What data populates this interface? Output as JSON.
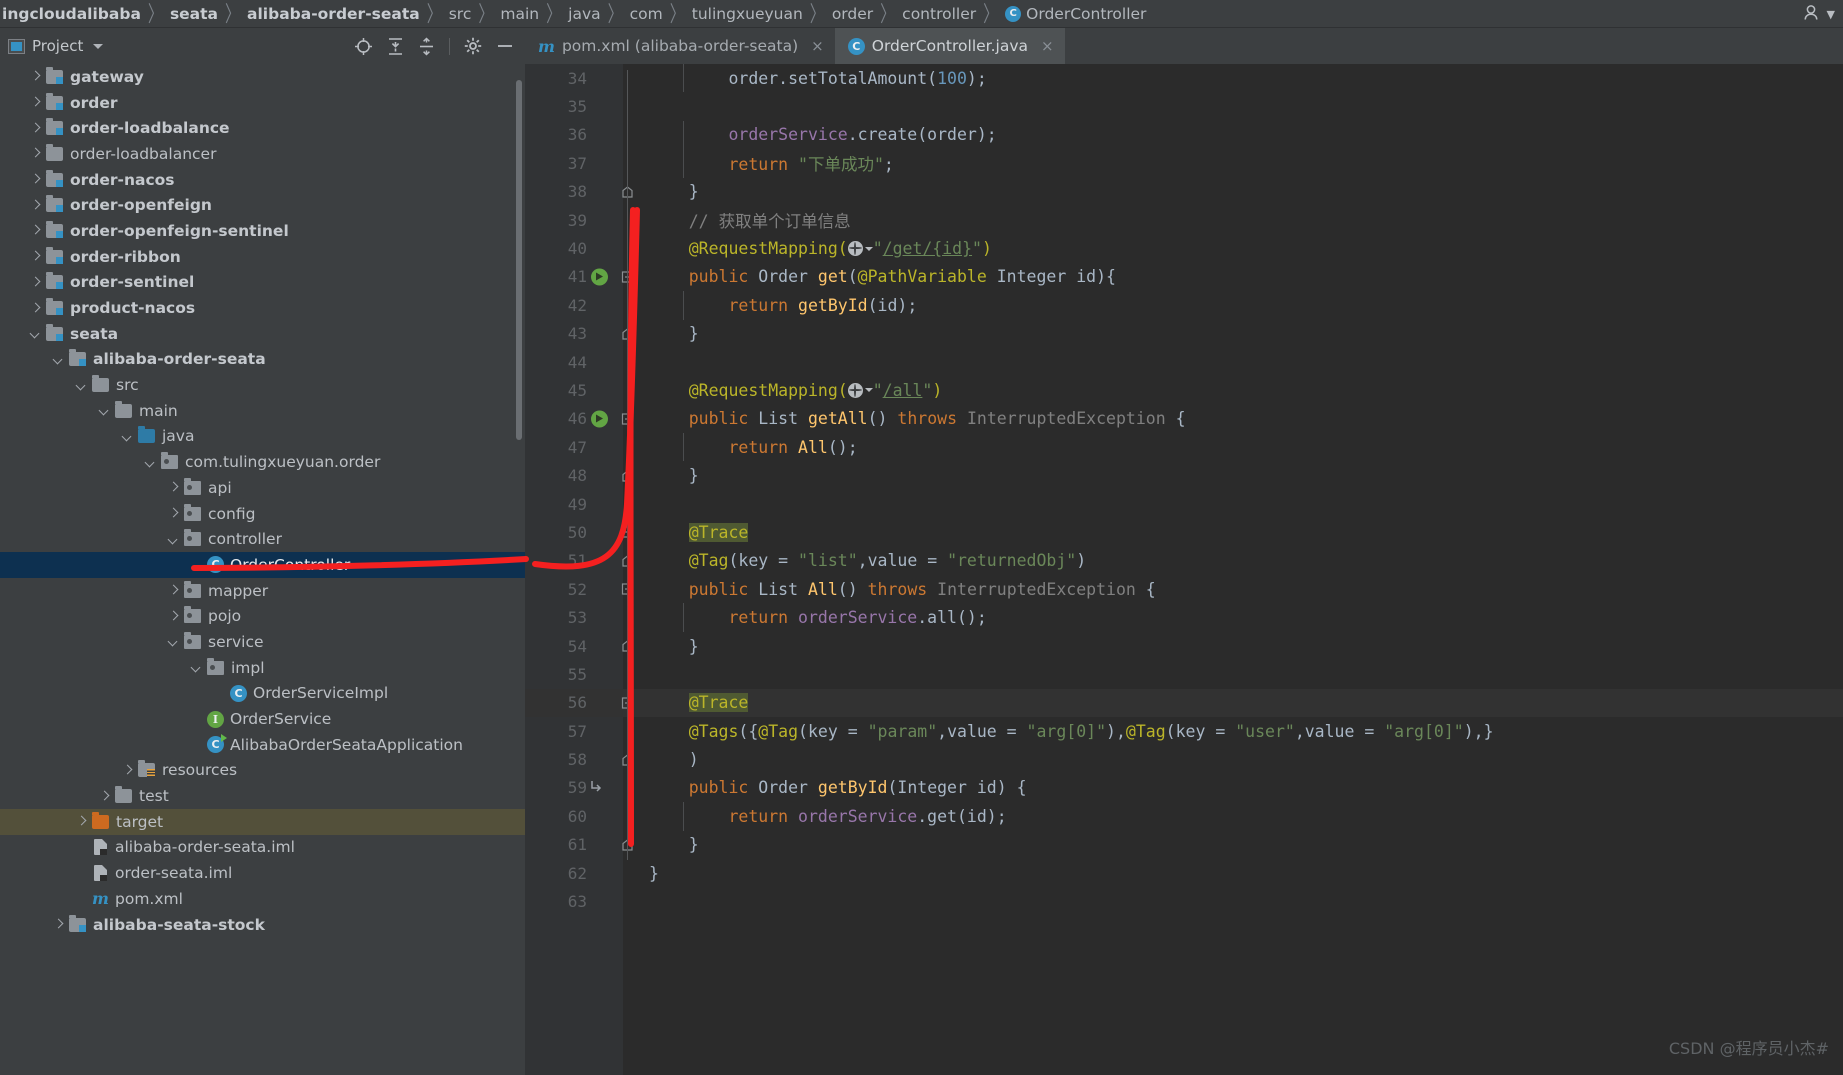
{
  "breadcrumb": {
    "items": [
      {
        "label": "ingcloudalibaba",
        "bold": true
      },
      {
        "label": "seata",
        "bold": true
      },
      {
        "label": "alibaba-order-seata",
        "bold": true
      },
      {
        "label": "src",
        "bold": false
      },
      {
        "label": "main",
        "bold": false
      },
      {
        "label": "java",
        "bold": false
      },
      {
        "label": "com",
        "bold": false
      },
      {
        "label": "tulingxueyuan",
        "bold": false
      },
      {
        "label": "order",
        "bold": false
      },
      {
        "label": "controller",
        "bold": false
      },
      {
        "label": "OrderController",
        "bold": false,
        "icon": "class-icon"
      }
    ],
    "separator": "〉",
    "account_icon": "account-icon",
    "account_caret": "▾"
  },
  "tool_window": {
    "title": "Project",
    "caret": "chevron-down-icon",
    "actions": [
      {
        "name": "locate-icon"
      },
      {
        "name": "expand-all-icon"
      },
      {
        "name": "collapse-all-icon"
      },
      {
        "name": "gear-icon"
      },
      {
        "name": "hide-icon"
      }
    ]
  },
  "tabs": [
    {
      "label": "pom.xml (alibaba-order-seata)",
      "icon": "maven-icon",
      "active": false,
      "close": "×"
    },
    {
      "label": "OrderController.java",
      "icon": "class-icon",
      "active": true,
      "close": "×"
    }
  ],
  "tree": [
    {
      "label": "gateway",
      "indent": 1,
      "arrow": "closed",
      "icon": "module-folder",
      "bold": true
    },
    {
      "label": "order",
      "indent": 1,
      "arrow": "closed",
      "icon": "module-folder",
      "bold": true
    },
    {
      "label": "order-loadbalance",
      "indent": 1,
      "arrow": "closed",
      "icon": "module-folder",
      "bold": true
    },
    {
      "label": "order-loadbalancer",
      "indent": 1,
      "arrow": "closed",
      "icon": "folder",
      "bold": false
    },
    {
      "label": "order-nacos",
      "indent": 1,
      "arrow": "closed",
      "icon": "module-folder",
      "bold": true
    },
    {
      "label": "order-openfeign",
      "indent": 1,
      "arrow": "closed",
      "icon": "module-folder",
      "bold": true
    },
    {
      "label": "order-openfeign-sentinel",
      "indent": 1,
      "arrow": "closed",
      "icon": "module-folder",
      "bold": true
    },
    {
      "label": "order-ribbon",
      "indent": 1,
      "arrow": "closed",
      "icon": "module-folder",
      "bold": true
    },
    {
      "label": "order-sentinel",
      "indent": 1,
      "arrow": "closed",
      "icon": "module-folder",
      "bold": true
    },
    {
      "label": "product-nacos",
      "indent": 1,
      "arrow": "closed",
      "icon": "module-folder",
      "bold": true
    },
    {
      "label": "seata",
      "indent": 1,
      "arrow": "open",
      "icon": "module-folder",
      "bold": true
    },
    {
      "label": "alibaba-order-seata",
      "indent": 2,
      "arrow": "open",
      "icon": "module-folder",
      "bold": true
    },
    {
      "label": "src",
      "indent": 3,
      "arrow": "open",
      "icon": "folder",
      "bold": false
    },
    {
      "label": "main",
      "indent": 4,
      "arrow": "open",
      "icon": "folder",
      "bold": false
    },
    {
      "label": "java",
      "indent": 5,
      "arrow": "open",
      "icon": "source-folder",
      "bold": false
    },
    {
      "label": "com.tulingxueyuan.order",
      "indent": 6,
      "arrow": "open",
      "icon": "package",
      "bold": false
    },
    {
      "label": "api",
      "indent": 7,
      "arrow": "closed",
      "icon": "package",
      "bold": false
    },
    {
      "label": "config",
      "indent": 7,
      "arrow": "closed",
      "icon": "package",
      "bold": false
    },
    {
      "label": "controller",
      "indent": 7,
      "arrow": "open",
      "icon": "package",
      "bold": false
    },
    {
      "label": "OrderController",
      "indent": 8,
      "arrow": "none",
      "icon": "class",
      "bold": false,
      "selected": true
    },
    {
      "label": "mapper",
      "indent": 7,
      "arrow": "closed",
      "icon": "package",
      "bold": false
    },
    {
      "label": "pojo",
      "indent": 7,
      "arrow": "closed",
      "icon": "package",
      "bold": false
    },
    {
      "label": "service",
      "indent": 7,
      "arrow": "open",
      "icon": "package",
      "bold": false
    },
    {
      "label": "impl",
      "indent": 8,
      "arrow": "open",
      "icon": "package",
      "bold": false
    },
    {
      "label": "OrderServiceImpl",
      "indent": 9,
      "arrow": "none",
      "icon": "class",
      "bold": false
    },
    {
      "label": "OrderService",
      "indent": 8,
      "arrow": "none",
      "icon": "interface",
      "bold": false
    },
    {
      "label": "AlibabaOrderSeataApplication",
      "indent": 8,
      "arrow": "none",
      "icon": "springboot",
      "bold": false
    },
    {
      "label": "resources",
      "indent": 5,
      "arrow": "closed",
      "icon": "resources-folder",
      "bold": false
    },
    {
      "label": "test",
      "indent": 4,
      "arrow": "closed",
      "icon": "folder",
      "bold": false
    },
    {
      "label": "target",
      "indent": 3,
      "arrow": "closed",
      "icon": "excluded-folder",
      "bold": false,
      "excluded": true
    },
    {
      "label": "alibaba-order-seata.iml",
      "indent": 3,
      "arrow": "none",
      "icon": "iml",
      "bold": false
    },
    {
      "label": "order-seata.iml",
      "indent": 3,
      "arrow": "none",
      "icon": "iml",
      "bold": false
    },
    {
      "label": "pom.xml",
      "indent": 3,
      "arrow": "none",
      "icon": "maven",
      "bold": false
    },
    {
      "label": "alibaba-seata-stock",
      "indent": 2,
      "arrow": "closed",
      "icon": "module-folder",
      "bold": true
    }
  ],
  "code": {
    "first_line": 34,
    "lines": [
      {
        "n": 34,
        "indent": 2
      },
      {
        "n": 35
      },
      {
        "n": 36,
        "indent": 2
      },
      {
        "n": 37,
        "indent": 2
      },
      {
        "n": 38,
        "indent": 1,
        "fold": "end"
      },
      {
        "n": 39,
        "indent": 1
      },
      {
        "n": 40,
        "indent": 1
      },
      {
        "n": 41,
        "indent": 1,
        "fold": "start",
        "run": true
      },
      {
        "n": 42,
        "indent": 2
      },
      {
        "n": 43,
        "indent": 1,
        "fold": "end"
      },
      {
        "n": 44
      },
      {
        "n": 45,
        "indent": 1
      },
      {
        "n": 46,
        "indent": 1,
        "fold": "start",
        "run": true
      },
      {
        "n": 47,
        "indent": 2
      },
      {
        "n": 48,
        "indent": 1,
        "fold": "end"
      },
      {
        "n": 49
      },
      {
        "n": 50,
        "indent": 1,
        "fold": "start"
      },
      {
        "n": 51,
        "indent": 1,
        "fold": "end"
      },
      {
        "n": 52,
        "indent": 1,
        "fold": "start"
      },
      {
        "n": 53,
        "indent": 2
      },
      {
        "n": 54,
        "indent": 1,
        "fold": "end"
      },
      {
        "n": 55
      },
      {
        "n": 56,
        "indent": 1,
        "fold": "start",
        "current": true
      },
      {
        "n": 57,
        "indent": 1
      },
      {
        "n": 58,
        "indent": 1,
        "fold": "end"
      },
      {
        "n": 59,
        "indent": 1,
        "override": true
      },
      {
        "n": 60,
        "indent": 2
      },
      {
        "n": 61,
        "indent": 1,
        "fold": "end"
      },
      {
        "n": 62
      },
      {
        "n": 63
      }
    ],
    "text": {
      "l34_a": "order",
      "l34_b": ".setTotalAmount(",
      "l34_num": "100",
      "l34_c": ");",
      "l36_a": "orderService",
      "l36_b": ".create(order);",
      "l37_kw": "return",
      "l37_str": "\"下单成功\"",
      "l37_end": ";",
      "l38": "}",
      "l39_cmt": "//",
      "l39_text": "获取单个订单信息",
      "l40_anno": "@RequestMapping(",
      "l40_str_open": "\"",
      "l40_url": "/get/{id}",
      "l40_str_close": "\"",
      "l40_end": ")",
      "l41_kw": "public",
      "l41_type": "Order",
      "l41_fn": "get",
      "l41_open": "(",
      "l41_anno": "@PathVariable",
      "l41_param": "Integer id",
      "l41_close": "){",
      "l42_kw": "return",
      "l42_fn": "getById",
      "l42_end": "(id);",
      "l43": "}",
      "l45_anno": "@RequestMapping(",
      "l45_url": "/all",
      "l45_end": ")",
      "l46_kw": "public",
      "l46_type": "List<Order>",
      "l46_fn": "getAll",
      "l46_mid": "() ",
      "l46_kw2": "throws",
      "l46_exc": "InterruptedException",
      "l46_brace": " {",
      "l47_kw": "return",
      "l47_fn": "All",
      "l47_end": "();",
      "l48": "}",
      "l50_anno": "@Trace",
      "l51_anno": "@Tag",
      "l51_open": "(key = ",
      "l51_str1": "\"list\"",
      "l51_mid": ",value = ",
      "l51_str2": "\"returnedObj\"",
      "l51_close": ")",
      "l52_kw": "public",
      "l52_type": "List<Order>",
      "l52_fn": "All",
      "l52_mid": "() ",
      "l52_kw2": "throws",
      "l52_exc": "InterruptedException",
      "l52_brace": " {",
      "l53_kw": "return",
      "l53_field": "orderService",
      "l53_call": ".all();",
      "l54": "}",
      "l56_anno": "@Trace",
      "l57_anno1": "@Tags",
      "l57_p1": "({",
      "l57_anno2": "@Tag",
      "l57_p2": "(key = ",
      "l57_s1": "\"param\"",
      "l57_p3": ",value = ",
      "l57_s2": "\"arg[0]\"",
      "l57_p4": "),",
      "l57_anno3": "@Tag",
      "l57_p5": "(key = ",
      "l57_s3": "\"user\"",
      "l57_p6": ",value = ",
      "l57_s4": "\"arg[0]\"",
      "l57_p7": "),}",
      "l58": ")",
      "l59_kw": "public",
      "l59_type": "Order",
      "l59_fn": "getById",
      "l59_params": "(Integer id) {",
      "l60_kw": "return",
      "l60_field": "orderService",
      "l60_call": ".get(id);",
      "l61": "}",
      "l62": "}"
    }
  },
  "watermark": "CSDN @程序员小杰#"
}
